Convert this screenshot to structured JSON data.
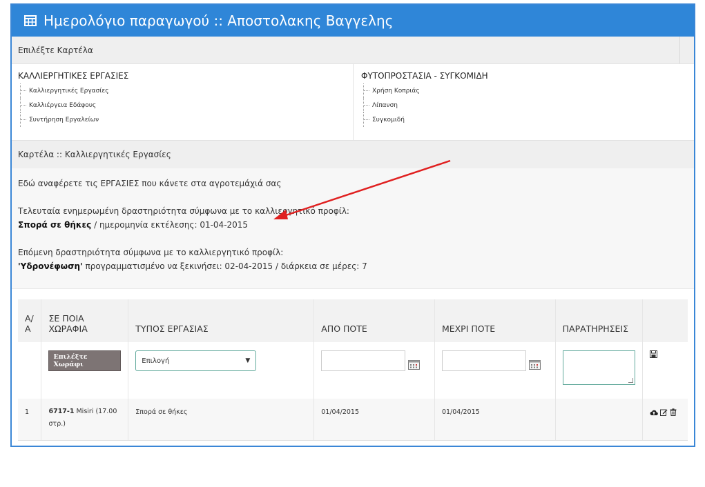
{
  "header": {
    "title": "Ημερολόγιο παραγωγού :: Αποστολακης Βαγγελης",
    "icon": "calendar-icon"
  },
  "select_tab": {
    "label": "Επιλέξτε Καρτέλα"
  },
  "menu": {
    "left": {
      "title": "ΚΑΛΛΙΕΡΓΗΤΙΚΕΣ ΕΡΓΑΣΙΕΣ",
      "items": [
        "Καλλιεργητικές Εργασίες",
        "Καλλιέργεια Εδάφους",
        "Συντήρηση Εργαλείων"
      ]
    },
    "right": {
      "title": "ΦΥΤΟΠΡΟΣΤΑΣΙΑ - ΣΥΓΚΟΜΙΔΗ",
      "items": [
        "Χρήση Κοπριάς",
        "Λίπανση",
        "Συγκομιδή"
      ]
    }
  },
  "card": {
    "title": "Καρτέλα :: Καλλιεργητικές Εργασίες"
  },
  "info": {
    "intro": "Εδώ αναφέρετε τις ΕΡΓΑΣΙΕΣ που κάνετε στα αγροτεμάχιά σας",
    "last_label": "Τελευταία ενημερωμένη δραστηριότητα σύμφωνα με το καλλιεργητικό προφίλ:",
    "last_activity": "Σπορά σε θήκες",
    "last_date_text": " / ημερομηνία εκτέλεσης: 01-04-2015",
    "next_label": "Επόμενη δραστηριότητα σύμφωνα με το καλλιεργητικό προφίλ:",
    "next_activity": "'Υδρονέφωση'",
    "next_text": " προγραμματισμένο να ξεκινήσει: 02-04-2015 / διάρκεια σε μέρες: 7"
  },
  "table": {
    "headers": {
      "aa": "Α/Α",
      "field": "ΣΕ ΠΟΙΑ ΧΩΡΑΦΙΑ",
      "type": "ΤΥΠΟΣ ΕΡΓΑΣΙΑΣ",
      "from": "ΑΠΟ ΠΟΤΕ",
      "to": "ΜΕΧΡΙ ΠΟΤΕ",
      "notes": "ΠΑΡΑΤΗΡΗΣΕΙΣ"
    },
    "edit": {
      "pick_field_label": "Επιλέξτε Χωράφι",
      "type_select_value": "Επιλογή"
    },
    "rows": [
      {
        "aa": "1",
        "field_code": "6717-1",
        "field_name": " Misiri (17.00 στρ.)",
        "type": "Σπορά σε θήκες",
        "from": "01/04/2015",
        "to": "01/04/2015",
        "notes": ""
      }
    ]
  },
  "colors": {
    "header_bg": "#2f86d8",
    "border": "#3a86d6",
    "accent_arrow": "#e02020",
    "button": "#7d7474"
  }
}
